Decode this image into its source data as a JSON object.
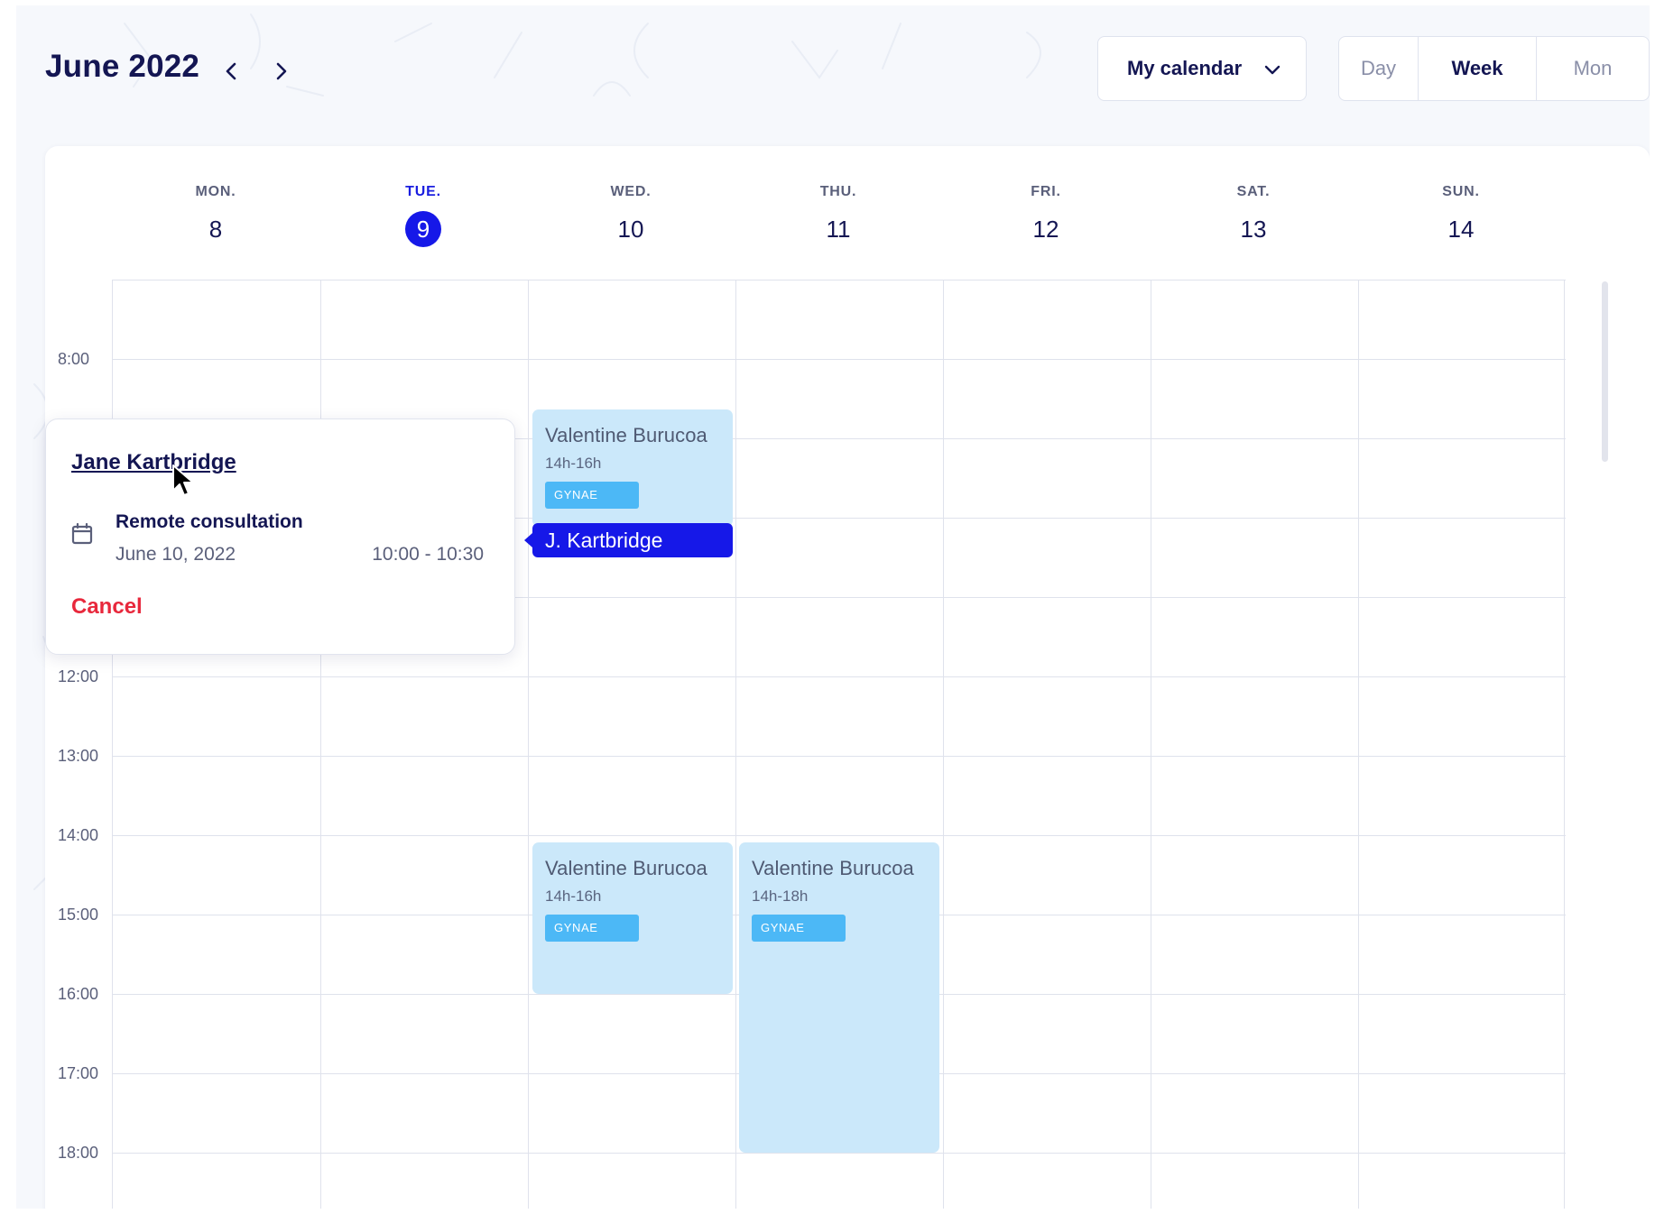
{
  "header": {
    "month_title": "June 2022",
    "prev_icon": "chevron-left-icon",
    "next_icon": "chevron-right-icon",
    "calendar_select": {
      "value": "My calendar",
      "icon": "chevron-down-icon"
    },
    "views": [
      {
        "label": "Day",
        "active": false
      },
      {
        "label": "Week",
        "active": true
      },
      {
        "label": "Mon",
        "active": false
      }
    ]
  },
  "week": {
    "days": [
      {
        "name": "MON.",
        "num": "8",
        "today": false
      },
      {
        "name": "TUE.",
        "num": "9",
        "today": true
      },
      {
        "name": "WED.",
        "num": "10",
        "today": false
      },
      {
        "name": "THU.",
        "num": "11",
        "today": false
      },
      {
        "name": "FRI.",
        "num": "12",
        "today": false
      },
      {
        "name": "SAT.",
        "num": "13",
        "today": false
      },
      {
        "name": "SUN.",
        "num": "14",
        "today": false
      }
    ],
    "time_labels": [
      "8:00",
      "12:00",
      "13:00",
      "14:00",
      "15:00",
      "16:00",
      "17:00",
      "18:00"
    ]
  },
  "events": [
    {
      "title": "Valentine Burucoa",
      "time": "14h-16h",
      "tag": "GYNAE"
    },
    {
      "title": "Valentine Burucoa",
      "time": "14h-16h",
      "tag": "GYNAE"
    },
    {
      "title": "Valentine Burucoa",
      "time": "14h-18h",
      "tag": "GYNAE"
    }
  ],
  "appointment": {
    "label": "J. Kartbridge"
  },
  "popover": {
    "patient_name": "Jane Kartbridge",
    "type": "Remote consultation",
    "date": "June 10, 2022",
    "hours": "10:00 - 10:30",
    "cancel_label": "Cancel",
    "icon": "calendar-icon"
  },
  "colors": {
    "primary": "#1618e8",
    "text_dark": "#141653",
    "event_bg": "#cbe8fa",
    "tag_bg": "#4cb8f6",
    "cancel": "#e8283c"
  }
}
